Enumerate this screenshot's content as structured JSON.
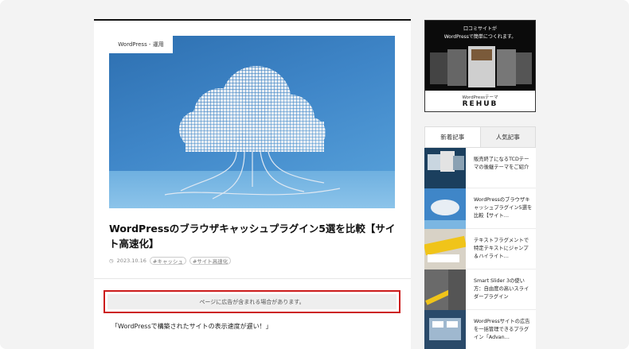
{
  "article": {
    "category": "WordPress - 運用",
    "title": "WordPressのブラウザキャッシュプラグイン5選を比較【サイト高速化】",
    "date": "2023.10.16",
    "tags": [
      "#キャッシュ",
      "#サイト高速化"
    ],
    "ad_notice": "ページに広告が含まれる場合があります。",
    "intro": "「WordPressで構築されたサイトの表示速度が遅い！」"
  },
  "sidebar": {
    "banner": {
      "line1": "口コミサイトが",
      "line2": "WordPressで簡単につくれます。",
      "footer_small": "WordPressテーマ",
      "footer_logo": "REHUB"
    },
    "tabs": [
      {
        "label": "新着記事"
      },
      {
        "label": "人気記事"
      }
    ],
    "posts": [
      {
        "title": "販売終了になるTCDテーマの後継テーマをご紹介"
      },
      {
        "title": "WordPressのブラウザキャッシュプラグイン5選を比較【サイト…"
      },
      {
        "title": "テキストフラグメントで特定テキストにジャンプ＆ハイライト…"
      },
      {
        "title": "Smart Slider 3の使い方：自由度の高いスライダープラグイン"
      },
      {
        "title": "WordPressサイトの広告を一括管理できるプラグイン「Advan…"
      }
    ]
  },
  "colors": {
    "accent_border": "#cc1b1b",
    "hero_blue": "#3f86c8"
  }
}
